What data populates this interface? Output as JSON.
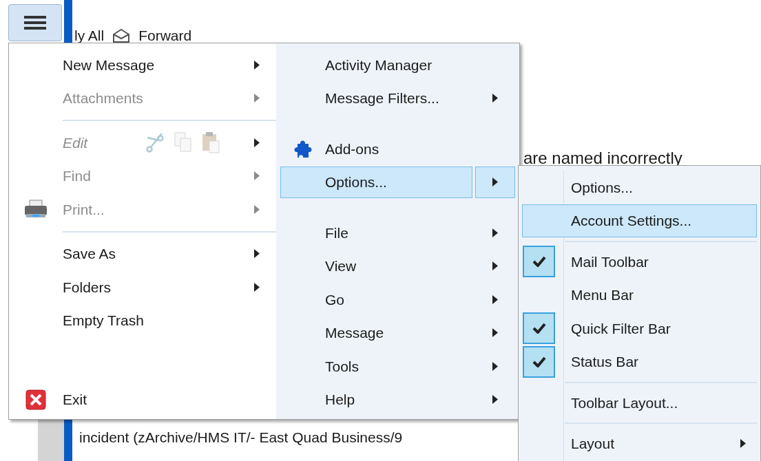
{
  "background": {
    "toolbar_texts": [
      "ly All",
      "Forward"
    ],
    "message_text": "are named incorrectly",
    "folder_text": "incident (zArchive/HMS IT/- East Quad Business/9"
  },
  "app_menu": {
    "left": [
      {
        "kind": "item",
        "label": "New Message",
        "disabled": false,
        "submenu": true
      },
      {
        "kind": "item",
        "label": "Attachments",
        "disabled": true,
        "submenu": true
      },
      {
        "kind": "separator"
      },
      {
        "kind": "clipboard",
        "label": "Edit",
        "disabled": true,
        "submenu": true
      },
      {
        "kind": "item",
        "label": "Find",
        "disabled": true,
        "submenu": true
      },
      {
        "kind": "printer",
        "label": "Print...",
        "disabled": true,
        "submenu": true
      },
      {
        "kind": "separator"
      },
      {
        "kind": "item",
        "label": "Save As",
        "disabled": false,
        "submenu": true
      },
      {
        "kind": "item",
        "label": "Folders",
        "disabled": false,
        "submenu": true
      },
      {
        "kind": "item",
        "label": "Empty Trash",
        "disabled": false,
        "submenu": false
      },
      {
        "kind": "spacer"
      },
      {
        "kind": "exit",
        "label": "Exit",
        "disabled": false,
        "submenu": false
      }
    ],
    "right": [
      {
        "kind": "item",
        "label": "Activity Manager",
        "submenu": false,
        "selected": false
      },
      {
        "kind": "item",
        "label": "Message Filters...",
        "submenu": true,
        "selected": false
      },
      {
        "kind": "spacer"
      },
      {
        "kind": "addons",
        "label": "Add-ons",
        "submenu": false,
        "selected": false
      },
      {
        "kind": "item",
        "label": "Options...",
        "submenu": true,
        "selected": true
      },
      {
        "kind": "spacer"
      },
      {
        "kind": "item",
        "label": "File",
        "submenu": true,
        "selected": false
      },
      {
        "kind": "item",
        "label": "View",
        "submenu": true,
        "selected": false
      },
      {
        "kind": "item",
        "label": "Go",
        "submenu": true,
        "selected": false
      },
      {
        "kind": "item",
        "label": "Message",
        "submenu": true,
        "selected": false
      },
      {
        "kind": "item",
        "label": "Tools",
        "submenu": true,
        "selected": false
      },
      {
        "kind": "item",
        "label": "Help",
        "submenu": true,
        "selected": false
      }
    ]
  },
  "options_submenu": [
    {
      "kind": "item",
      "label": "Options...",
      "selected": false,
      "submenu": false
    },
    {
      "kind": "item",
      "label": "Account Settings...",
      "selected": true,
      "submenu": false
    },
    {
      "kind": "separator"
    },
    {
      "kind": "check",
      "label": "Mail Toolbar",
      "checked": true
    },
    {
      "kind": "check",
      "label": "Menu Bar",
      "checked": false
    },
    {
      "kind": "check",
      "label": "Quick Filter Bar",
      "checked": true
    },
    {
      "kind": "check",
      "label": "Status Bar",
      "checked": true
    },
    {
      "kind": "separator"
    },
    {
      "kind": "item",
      "label": "Toolbar Layout...",
      "selected": false,
      "submenu": false
    },
    {
      "kind": "separator"
    },
    {
      "kind": "item",
      "label": "Layout",
      "selected": false,
      "submenu": true
    }
  ]
}
